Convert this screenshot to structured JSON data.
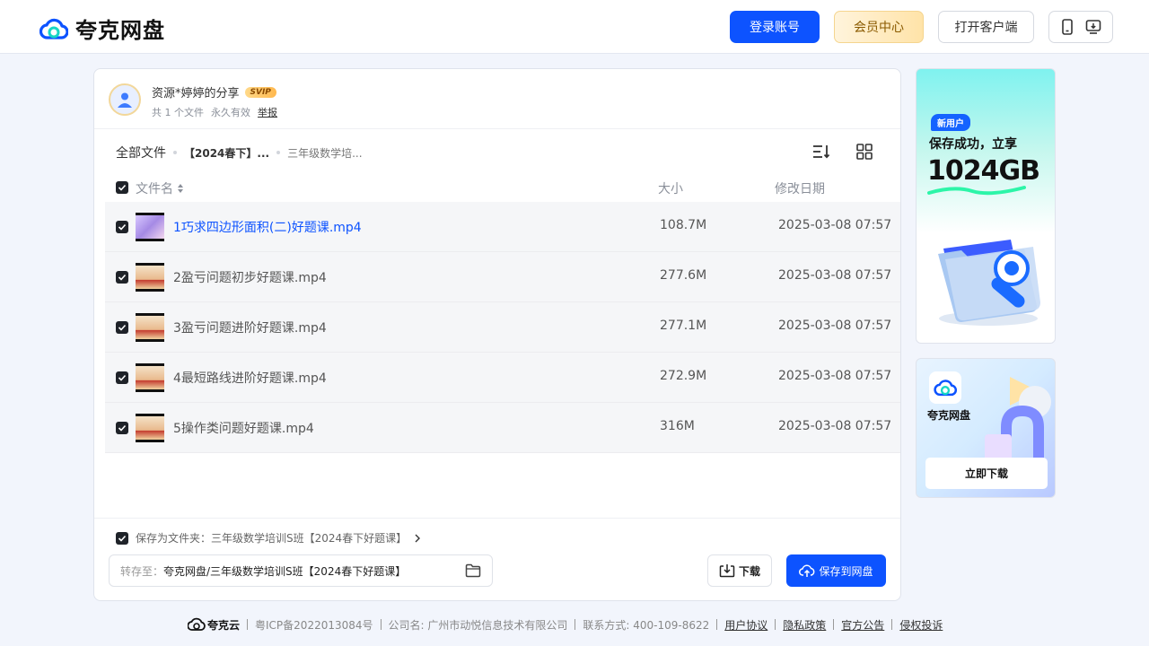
{
  "header": {
    "logo_text": "夸克网盘",
    "login_label": "登录账号",
    "vip_label": "会员中心",
    "client_label": "打开客户端"
  },
  "share": {
    "title": "资源*婷婷的分享",
    "badge": "SVIP",
    "file_count": "共 1 个文件",
    "validity": "永久有效",
    "report": "举报"
  },
  "breadcrumb": {
    "root": "全部文件",
    "mid": "【2024春下】...",
    "last": "三年级数学培..."
  },
  "table": {
    "col_name": "文件名",
    "col_size": "大小",
    "col_date": "修改日期",
    "rows": [
      {
        "name": "1巧求四边形面积(二)好题课.mp4",
        "size": "108.7M",
        "date": "2025-03-08 07:57"
      },
      {
        "name": "2盈亏问题初步好题课.mp4",
        "size": "277.6M",
        "date": "2025-03-08 07:57"
      },
      {
        "name": "3盈亏问题进阶好题课.mp4",
        "size": "277.1M",
        "date": "2025-03-08 07:57"
      },
      {
        "name": "4最短路线进阶好题课.mp4",
        "size": "272.9M",
        "date": "2025-03-08 07:57"
      },
      {
        "name": "5操作类问题好题课.mp4",
        "size": "316M",
        "date": "2025-03-08 07:57"
      }
    ]
  },
  "save": {
    "save_as_text": "保存为文件夹：三年级数学培训S班【2024春下好题课】",
    "target_label": "转存至：",
    "target_path": "夸克网盘/三年级数学培训S班【2024春下好题课】",
    "download_label": "下载",
    "save_label": "保存到网盘"
  },
  "ads": {
    "ad1_tag": "新用户",
    "ad1_line": "保存成功，立享",
    "ad1_big": "1024GB",
    "ad2_name": "夸克网盘",
    "ad2_button": "立即下载"
  },
  "footer": {
    "brand": "夸克云",
    "icp": "粤ICP备2022013084号",
    "company": "公司名: 广州市动悦信息技术有限公司",
    "contact": "联系方式: 400-109-8622",
    "links": [
      "用户协议",
      "隐私政策",
      "官方公告",
      "侵权投诉"
    ]
  },
  "colors": {
    "primary": "#0d53ff",
    "link": "#0d53ff"
  }
}
